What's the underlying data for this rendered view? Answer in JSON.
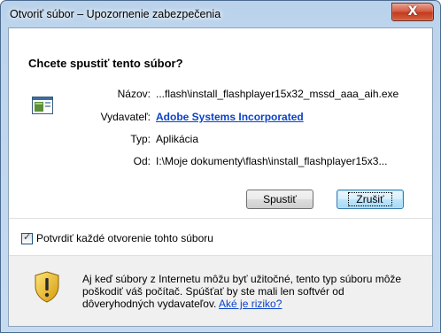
{
  "window": {
    "title": "Otvoriť súbor – Upozornenie zabezpečenia",
    "close_label": "X"
  },
  "dialog": {
    "heading": "Chcete spustiť tento súbor?",
    "fields": {
      "name_label": "Názov:",
      "name_value": "...flash\\install_flashplayer15x32_mssd_aaa_aih.exe",
      "publisher_label": "Vydavateľ:",
      "publisher_value": "Adobe Systems Incorporated",
      "type_label": "Typ:",
      "type_value": "Aplikácia",
      "from_label": "Od:",
      "from_value": "I:\\Moje dokumenty\\flash\\install_flashplayer15x3..."
    },
    "buttons": {
      "run": "Spustiť",
      "cancel": "Zrušiť"
    },
    "checkbox": {
      "label": "Potvrdiť každé otvorenie tohto súboru",
      "checked": true
    },
    "warning": {
      "text": "Aj keď súbory z Internetu môžu byť užitočné, tento typ súboru môže poškodiť váš počítač. Spúšťať by ste mali len softvér od dôveryhodných vydavateľov.",
      "link": "Aké je riziko?"
    }
  },
  "colors": {
    "frame": "#bcd4ec",
    "link": "#0a43c9",
    "close": "#c33b1f"
  },
  "icons": {
    "file": "application-window-icon",
    "warning": "security-shield-icon"
  }
}
